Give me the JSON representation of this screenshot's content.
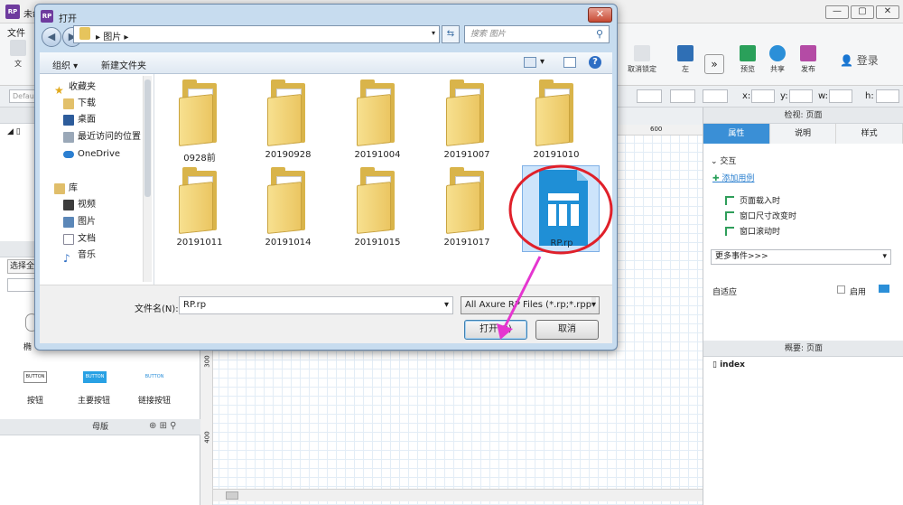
{
  "app": {
    "title": "未命名",
    "menu_file": "文件",
    "login": "登录",
    "toolbar": [
      {
        "label": "取消锁定"
      },
      {
        "label": "左"
      },
      {
        "label": "预览"
      },
      {
        "label": "共享"
      },
      {
        "label": "发布"
      }
    ],
    "fmt": {
      "style_value": "Default",
      "x": "x:",
      "y": "y:",
      "w": "w:",
      "h": "h:"
    },
    "left_panel": {
      "libraries_label": "选择全",
      "widgets": [
        {
          "label": "按钮",
          "sample": "BUTTON"
        },
        {
          "label": "主要按钮",
          "sample": "BUTTON"
        },
        {
          "label": "链接按钮",
          "sample": "BUTTON"
        }
      ],
      "masters_title": "母版",
      "widget_partial": "椭"
    },
    "ruler": {
      "h600": "600",
      "v300": "300",
      "v400": "400"
    },
    "inspector": {
      "title": "检视: 页面",
      "tabs": [
        "属性",
        "说明",
        "样式"
      ],
      "section_interact": "交互",
      "add_case": "添加用例",
      "events": [
        "页面载入时",
        "窗口尺寸改变时",
        "窗口滚动时"
      ],
      "more_events": "更多事件>>>",
      "adaptive": "自适应",
      "enable": "启用"
    },
    "outline": {
      "title": "概要: 页面",
      "index": "index"
    }
  },
  "dialog": {
    "title": "打开",
    "breadcrumb": "图片",
    "search_placeholder": "搜索 图片",
    "organize": "组织 ▾",
    "new_folder": "新建文件夹",
    "tree": {
      "favorites": "收藏夹",
      "items": [
        "下载",
        "桌面",
        "最近访问的位置",
        "OneDrive"
      ],
      "library": "库",
      "lib_items": [
        "视频",
        "图片",
        "文档",
        "音乐"
      ]
    },
    "folders": [
      {
        "name": "0928前"
      },
      {
        "name": "20190928"
      },
      {
        "name": "20191004"
      },
      {
        "name": "20191007"
      },
      {
        "name": "20191010"
      },
      {
        "name": "20191011"
      },
      {
        "name": "20191014"
      },
      {
        "name": "20191015"
      },
      {
        "name": "20191017"
      }
    ],
    "selected_file": "RP.rp",
    "filename_label": "文件名(N):",
    "filename_value": "RP.rp",
    "filetype_value": "All Axure RP Files (*.rp;*.rppr",
    "open_button": "打开(O)",
    "cancel_button": "取消"
  },
  "colors": {
    "accent": "#3a8fd6",
    "annotation": "#e0202a",
    "arrow": "#e535d0"
  }
}
